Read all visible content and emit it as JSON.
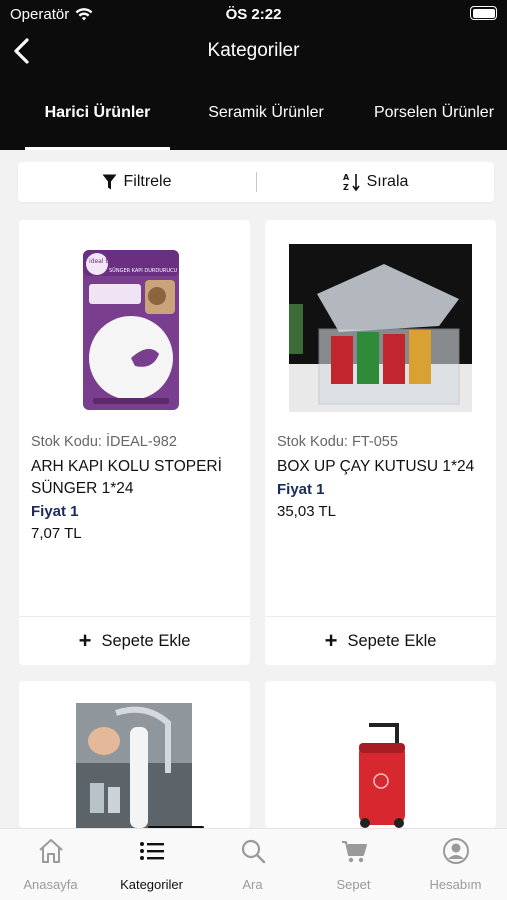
{
  "status_bar": {
    "carrier": "Operatör",
    "time": "ÖS 2:22"
  },
  "nav": {
    "title": "Kategoriler"
  },
  "tabs": [
    {
      "label": "Harici Ürünler",
      "active": true
    },
    {
      "label": "Seramik Ürünler",
      "active": false
    },
    {
      "label": "Porselen Ürünler",
      "active": false
    }
  ],
  "toolbar": {
    "filter_label": "Filtrele",
    "sort_label": "Sırala"
  },
  "products": [
    {
      "code": "Stok Kodu: İDEAL-982",
      "name": "ARH KAPI KOLU STOPERİ SÜNGER 1*24",
      "price_label": "Fiyat 1",
      "price": "7,07 TL",
      "add_label": "Sepete Ekle"
    },
    {
      "code": "Stok Kodu: FT-055",
      "name": "BOX UP ÇAY KUTUSU 1*24",
      "price_label": "Fiyat 1",
      "price": "35,03 TL",
      "add_label": "Sepete Ekle"
    }
  ],
  "package_brand": "ideal baby",
  "package_title": "SÜNGER KAPI DURDURUCU",
  "bottom_tabs": [
    {
      "label": "Anasayfa",
      "icon": "home-icon",
      "active": false
    },
    {
      "label": "Kategoriler",
      "icon": "list-icon",
      "active": true
    },
    {
      "label": "Ara",
      "icon": "search-icon",
      "active": false
    },
    {
      "label": "Sepet",
      "icon": "cart-icon",
      "active": false
    },
    {
      "label": "Hesabım",
      "icon": "account-icon",
      "active": false
    }
  ],
  "colors": {
    "header_bg": "#0c0c0c",
    "price_label": "#1a2b5c",
    "page_bg": "#f2f2f2"
  }
}
